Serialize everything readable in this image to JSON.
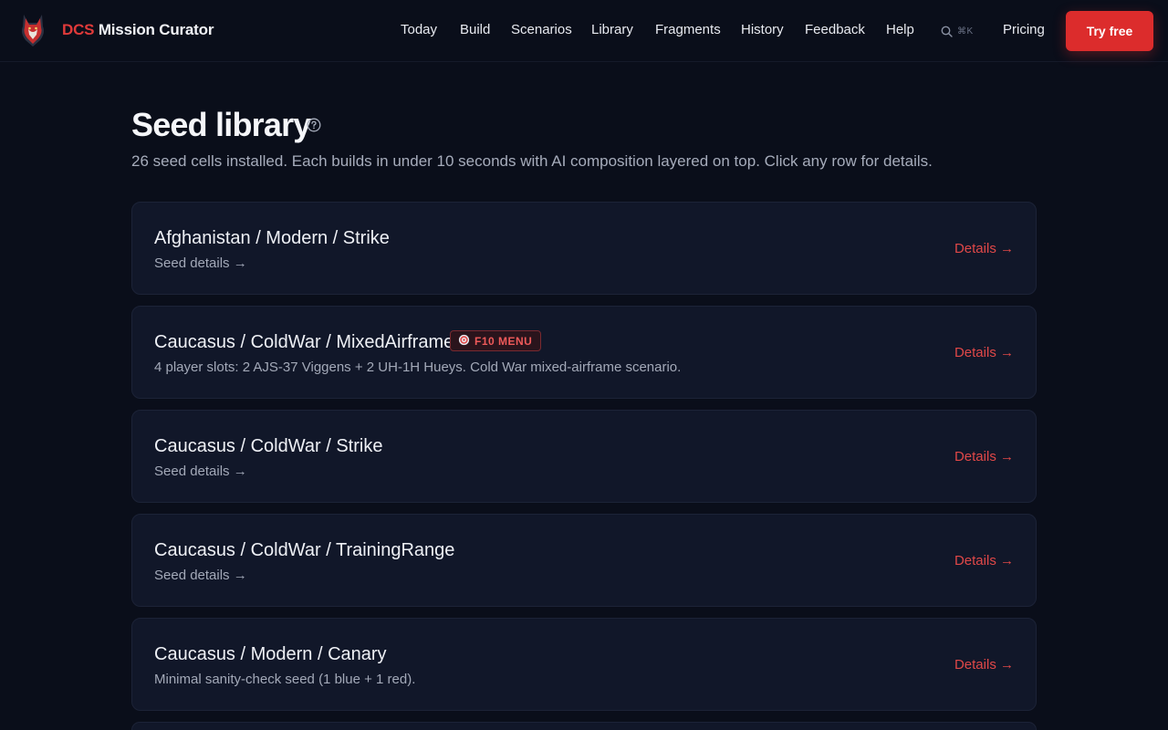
{
  "header": {
    "brand_accent": "DCS",
    "brand_rest": "Mission Curator",
    "nav": [
      "Today",
      "Build",
      "Scenarios",
      "Library",
      "Fragments",
      "History",
      "Feedback",
      "Help"
    ],
    "search_shortcut": "⌘K",
    "pricing_label": "Pricing",
    "cta_label": "Try free"
  },
  "page": {
    "title": "Seed library",
    "subtitle": "26 seed cells installed. Each builds in under 10 seconds with AI composition layered on top. Click any row for details."
  },
  "seeds": [
    {
      "title": "Afghanistan / Modern / Strike",
      "desc": "Seed details →",
      "link": "Details →",
      "badge": ""
    },
    {
      "title": "Caucasus / ColdWar / MixedAirframe",
      "desc": "4 player slots: 2 AJS-37 Viggens + 2 UH-1H Hueys. Cold War mixed-airframe scenario.",
      "link": "Details →",
      "badge": "F10 MENU"
    },
    {
      "title": "Caucasus / ColdWar / Strike",
      "desc": "Seed details →",
      "link": "Details →",
      "badge": ""
    },
    {
      "title": "Caucasus / ColdWar / TrainingRange",
      "desc": "Seed details →",
      "link": "Details →",
      "badge": ""
    },
    {
      "title": "Caucasus / Modern / Canary",
      "desc": "Minimal sanity-check seed (1 blue + 1 red).",
      "link": "Details →",
      "badge": ""
    }
  ],
  "colors": {
    "background": "#0a0e1a",
    "card": "#111729",
    "accent": "#dc2c2c",
    "link": "#e04848"
  },
  "icons": {
    "logo": "fox-head-logo",
    "search": "search-icon",
    "help": "help-circle-icon",
    "badge": "target-icon"
  }
}
